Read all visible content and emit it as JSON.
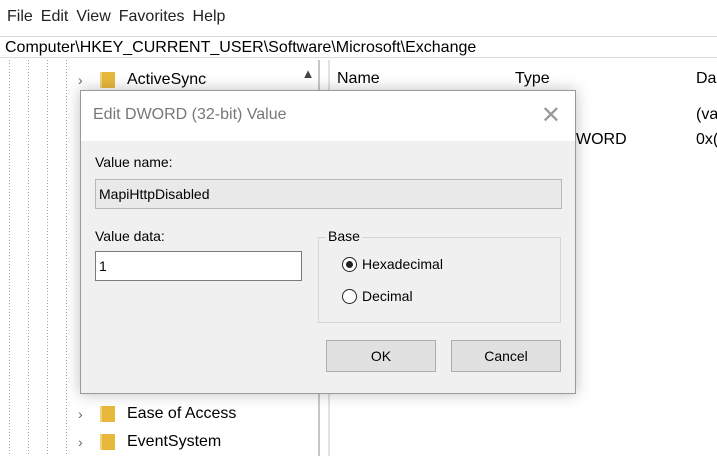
{
  "menu": [
    "File",
    "Edit",
    "View",
    "Favorites",
    "Help"
  ],
  "address_path": "Computer\\HKEY_CURRENT_USER\\Software\\Microsoft\\Exchange",
  "tree": {
    "items": [
      {
        "label": "ActiveSync"
      },
      {
        "label": "Ease of Access"
      },
      {
        "label": "EventSystem"
      }
    ]
  },
  "list": {
    "columns": [
      "Name",
      "Type",
      "Da"
    ],
    "rows": [
      {
        "data": "(va"
      },
      {
        "type": "WORD",
        "data": "0x("
      }
    ]
  },
  "dialog": {
    "title": "Edit DWORD (32-bit) Value",
    "value_name_label": "Value name:",
    "value_name": "MapiHttpDisabled",
    "value_data_label": "Value data:",
    "value_data": "1",
    "base_label": "Base",
    "base_options": [
      {
        "label": "Hexadecimal",
        "selected": true
      },
      {
        "label": "Decimal",
        "selected": false
      }
    ],
    "ok_label": "OK",
    "cancel_label": "Cancel"
  }
}
